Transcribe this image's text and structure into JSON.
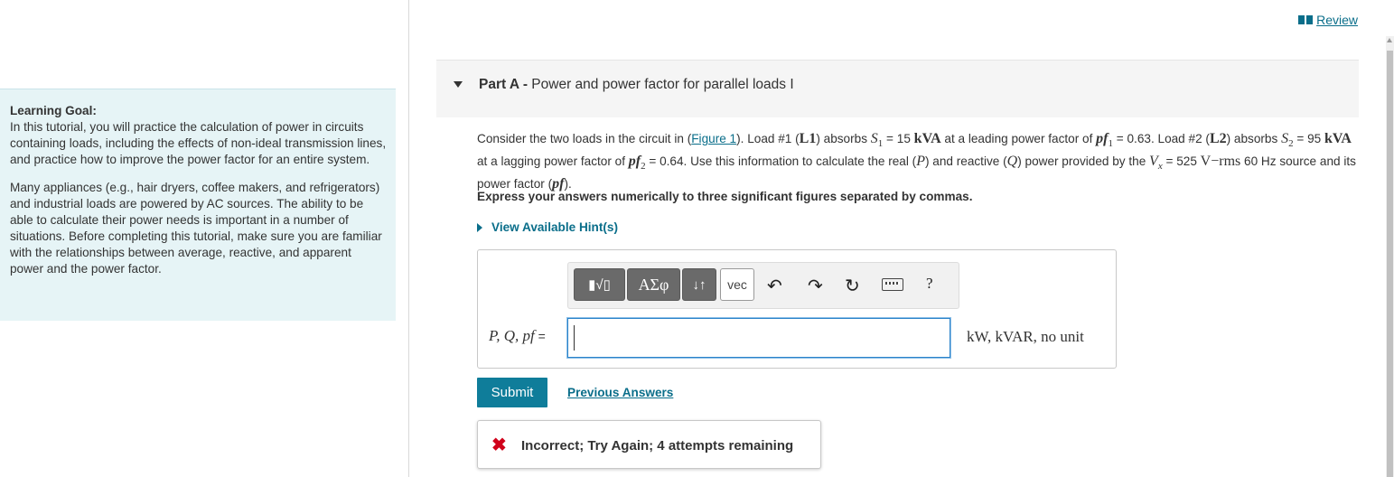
{
  "learning_goal": {
    "title": "Learning Goal:",
    "para1": "In this tutorial, you will practice the calculation of power in circuits containing loads, including the effects of non-ideal transmission lines, and practice how to improve the power factor for an entire system.",
    "para2": "Many appliances (e.g., hair dryers, coffee makers, and refrigerators) and industrial loads are powered by AC sources. The ability to be able to calculate their power needs is important in a number of situations. Before completing this tutorial, make sure you are familiar with the relationships between average, reactive, and apparent power and the power factor."
  },
  "header": {
    "review_label": "Review"
  },
  "part": {
    "label": "Part A",
    "sep": " - ",
    "title": "Power and power factor for parallel loads I"
  },
  "problem": {
    "t1": "Consider the two loads in the circuit in (",
    "figure_link": "Figure 1",
    "t2": "). Load #1 (",
    "l1": "L1",
    "t3": ") absorbs ",
    "s1_var": "S",
    "s1_sub": "1",
    "t4": " = 15 ",
    "kva1": "kVA",
    "t5": " at a leading power factor of ",
    "pf1_var": "pf",
    "pf1_sub": "1",
    "t6": " = 0.63. Load #2 (",
    "l2": "L2",
    "t7": ") absorbs ",
    "s2_var": "S",
    "s2_sub": "2",
    "t8": " = 95 ",
    "kva2": "kVA",
    "t9": " at a lagging power factor of ",
    "pf2_var": "pf",
    "pf2_sub": "2",
    "t10": " = 0.64. Use this information to calculate the real (",
    "p": "P",
    "t11": ") and reactive (",
    "q": "Q",
    "t12": ") power provided by the ",
    "vx_var": "V",
    "vx_sub": "x",
    "t13": " = 525 ",
    "vrms": "V−rms",
    "t14": " 60 Hz source and its power factor (",
    "pf": "pf",
    "t15": ")."
  },
  "instruction": "Express your answers numerically to three significant figures separated by commas.",
  "hint_label": "View Available Hint(s)",
  "toolbar": {
    "template_label": "▮√▯",
    "greek_label": "ΑΣφ",
    "arrows_label": "↓↑",
    "vec_label": "vec",
    "undo_icon": "↶",
    "redo_icon": "↷",
    "reset_icon": "↻",
    "help_label": "?"
  },
  "answer": {
    "label": "P, Q, pf",
    "equals": " =",
    "value": "",
    "units": "kW, kVAR, no unit"
  },
  "submit_label": "Submit",
  "previous_answers_label": "Previous Answers",
  "feedback": {
    "icon": "✖",
    "text": "Incorrect; Try Again; 4 attempts remaining"
  }
}
